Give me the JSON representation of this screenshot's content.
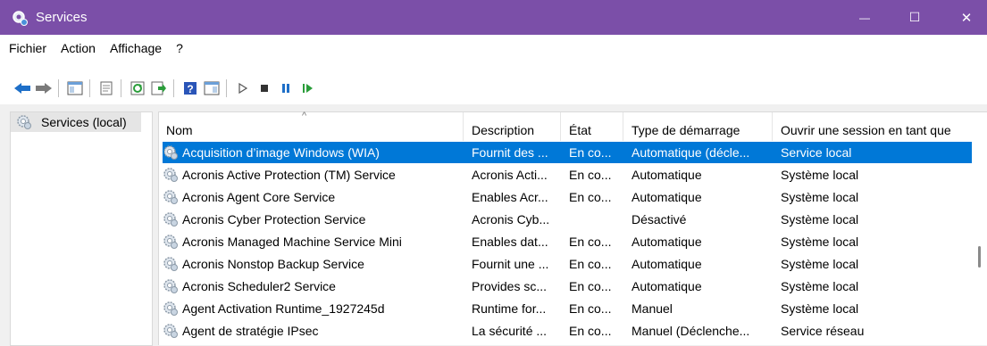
{
  "window": {
    "title": "Services",
    "minimize_glyph": "—",
    "maximize_glyph": "☐",
    "close_glyph": "✕"
  },
  "menu": [
    "Fichier",
    "Action",
    "Affichage",
    "?"
  ],
  "toolbar_icons": [
    "back-icon",
    "forward-icon",
    "show-console-tree-icon",
    "properties-icon",
    "refresh-icon",
    "export-list-icon",
    "help-icon",
    "show-hide-action-pane-icon",
    "start-service-icon",
    "stop-service-icon",
    "pause-service-icon",
    "resume-service-icon"
  ],
  "tree": {
    "label": "Services (local)"
  },
  "columns": {
    "name": "Nom",
    "description": "Description",
    "state": "État",
    "startup": "Type de démarrage",
    "logon": "Ouvrir une session en tant que",
    "sort_glyph": "^"
  },
  "services": [
    {
      "name": "Acquisition d’image Windows (WIA)",
      "description": "Fournit des ...",
      "state": "En co...",
      "startup": "Automatique (décle...",
      "logon": "Service local"
    },
    {
      "name": "Acronis Active Protection (TM) Service",
      "description": "Acronis Acti...",
      "state": "En co...",
      "startup": "Automatique",
      "logon": "Système local"
    },
    {
      "name": "Acronis Agent Core Service",
      "description": "Enables Acr...",
      "state": "En co...",
      "startup": "Automatique",
      "logon": "Système local"
    },
    {
      "name": "Acronis Cyber Protection Service",
      "description": "Acronis Cyb...",
      "state": "",
      "startup": "Désactivé",
      "logon": "Système local"
    },
    {
      "name": "Acronis Managed Machine Service Mini",
      "description": "Enables dat...",
      "state": "En co...",
      "startup": "Automatique",
      "logon": "Système local"
    },
    {
      "name": "Acronis Nonstop Backup Service",
      "description": "Fournit une ...",
      "state": "En co...",
      "startup": "Automatique",
      "logon": "Système local"
    },
    {
      "name": "Acronis Scheduler2 Service",
      "description": "Provides sc...",
      "state": "En co...",
      "startup": "Automatique",
      "logon": "Système local"
    },
    {
      "name": "Agent Activation Runtime_1927245d",
      "description": "Runtime for...",
      "state": "En co...",
      "startup": "Manuel",
      "logon": "Système local"
    },
    {
      "name": "Agent de stratégie IPsec",
      "description": "La sécurité ...",
      "state": "En co...",
      "startup": "Manuel (Déclenche...",
      "logon": "Service réseau"
    }
  ],
  "colors": {
    "titlebar": "#7b4fa8",
    "selection": "#0078d7"
  }
}
